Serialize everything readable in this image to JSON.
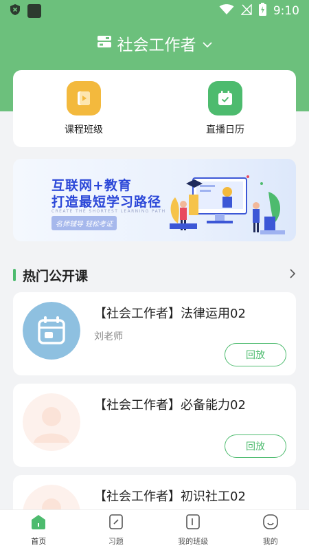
{
  "status": {
    "time": "9:10"
  },
  "header": {
    "title": "社会工作者"
  },
  "quick_actions": [
    {
      "label": "课程班级",
      "icon": "video-folder-icon"
    },
    {
      "label": "直播日历",
      "icon": "calendar-check-icon"
    }
  ],
  "banner": {
    "line1": "互联网+教育",
    "line2": "打造最短学习路径",
    "small": "CREATE THE SHORTEST LEARNING PATH",
    "tag": "名师辅导  轻松考证"
  },
  "section": {
    "title": "热门公开课"
  },
  "courses": [
    {
      "title": "【社会工作者】法律运用02",
      "teacher": "刘老师",
      "button": "回放",
      "avatar": "calendar-avatar"
    },
    {
      "title": "【社会工作者】必备能力02",
      "teacher": "",
      "button": "回放",
      "avatar": "default-person-avatar"
    },
    {
      "title": "【社会工作者】初识社工02",
      "teacher": "",
      "button": "",
      "avatar": "default-person-avatar"
    }
  ],
  "tabs": [
    {
      "label": "首页",
      "icon": "home-icon",
      "active": true
    },
    {
      "label": "习题",
      "icon": "exercise-icon",
      "active": false
    },
    {
      "label": "我的班级",
      "icon": "class-icon",
      "active": false
    },
    {
      "label": "我的",
      "icon": "profile-icon",
      "active": false
    }
  ],
  "colors": {
    "brand_green": "#6cc07c",
    "accent_green": "#4dbb6e",
    "yellow": "#f3b93d",
    "banner_blue": "#2b47d8"
  }
}
